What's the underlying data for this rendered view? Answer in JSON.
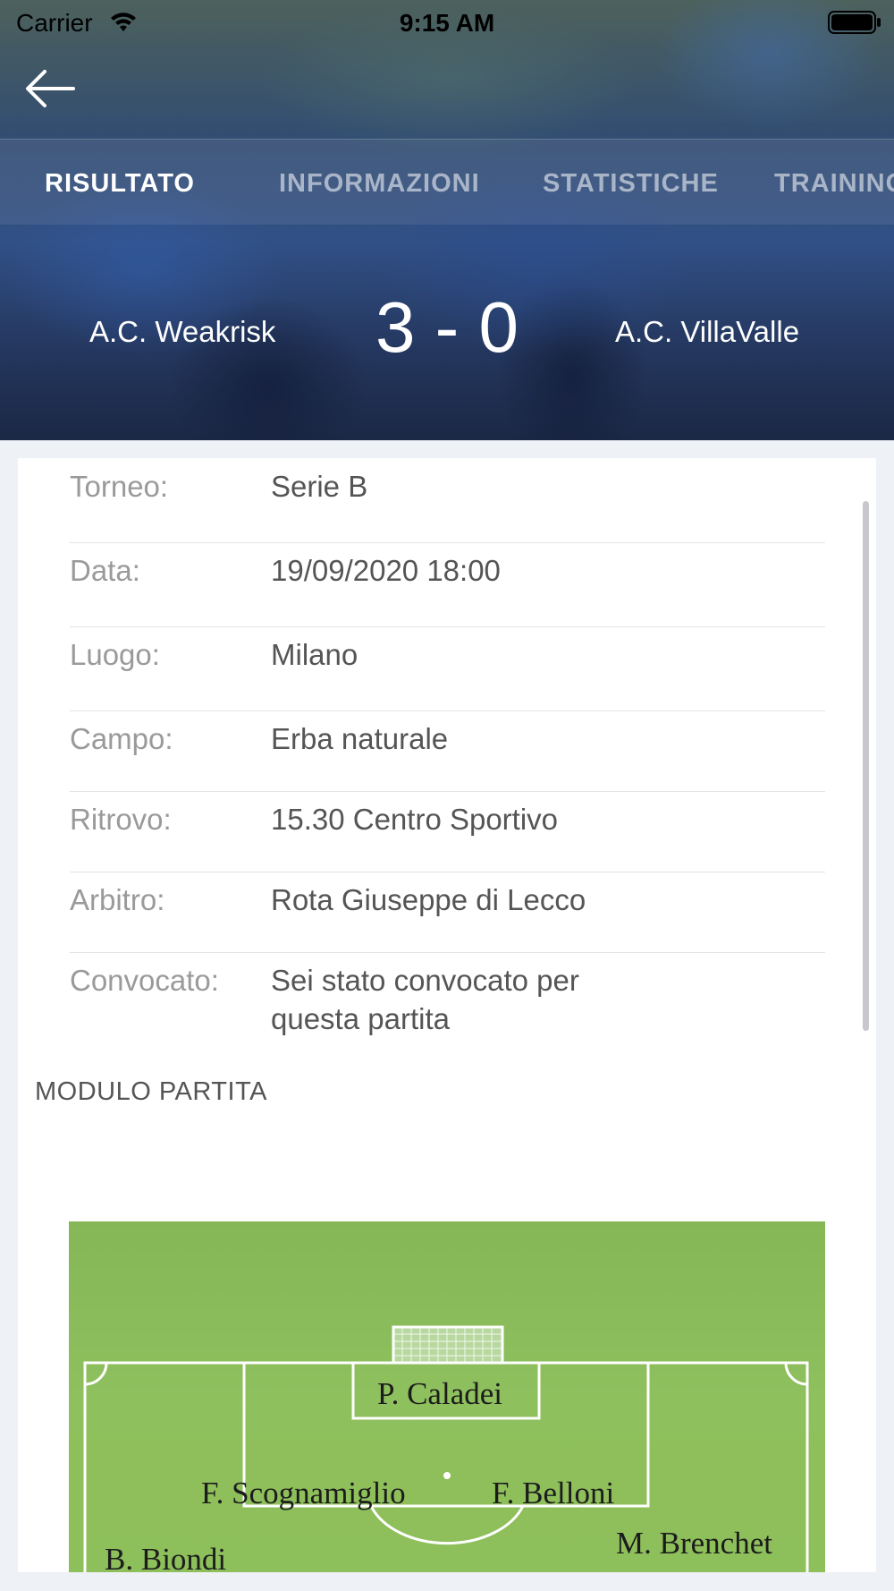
{
  "status_bar": {
    "carrier": "Carrier",
    "time": "9:15 AM"
  },
  "tabs": [
    "RISULTATO",
    "INFORMAZIONI",
    "STATISTICHE",
    "TRAINING"
  ],
  "active_tab": "RISULTATO",
  "match": {
    "home_team": "A.C. Weakrisk",
    "score": "3 - 0",
    "away_team": "A.C. VillaValle"
  },
  "details": [
    {
      "label": "Torneo:",
      "value": "Serie B"
    },
    {
      "label": "Data:",
      "value": "19/09/2020 18:00"
    },
    {
      "label": "Luogo:",
      "value": "Milano"
    },
    {
      "label": "Campo:",
      "value": "Erba naturale"
    },
    {
      "label": "Ritrovo:",
      "value": "15.30 Centro Sportivo"
    },
    {
      "label": "Arbitro:",
      "value": "Rota Giuseppe di Lecco"
    },
    {
      "label": "Convocato:",
      "value": "Sei stato convocato per questa partita"
    }
  ],
  "formation": {
    "title": "MODULO PARTITA",
    "players": [
      "P. Caladei",
      "F. Scognamiglio",
      "F. Belloni",
      "B. Biondi",
      "M. Brenchet"
    ]
  }
}
